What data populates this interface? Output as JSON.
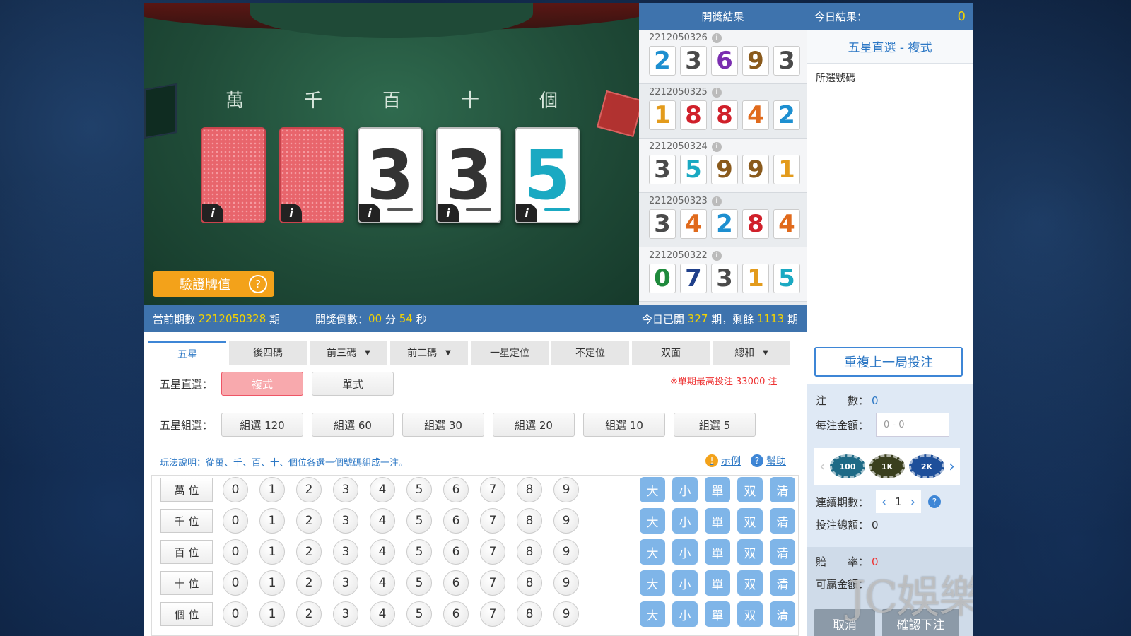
{
  "table": {
    "positions": [
      "萬",
      "千",
      "百",
      "十",
      "個"
    ],
    "cards": [
      "",
      "",
      "3",
      "3",
      "5"
    ],
    "card_info": "i",
    "verify_label": "驗證牌值",
    "verify_help": "?"
  },
  "results": {
    "title": "開獎結果",
    "draws": [
      {
        "id": "2212050326",
        "nums": [
          "2",
          "3",
          "6",
          "9",
          "3"
        ]
      },
      {
        "id": "2212050325",
        "nums": [
          "1",
          "8",
          "8",
          "4",
          "2"
        ]
      },
      {
        "id": "2212050324",
        "nums": [
          "3",
          "5",
          "9",
          "9",
          "1"
        ]
      },
      {
        "id": "2212050323",
        "nums": [
          "3",
          "4",
          "2",
          "8",
          "4"
        ]
      },
      {
        "id": "2212050322",
        "nums": [
          "0",
          "7",
          "3",
          "1",
          "5"
        ]
      }
    ],
    "digit_colors": {
      "0": "#1f8a3c",
      "1": "#e39b1c",
      "2": "#1d8fd0",
      "3": "#4a4a4a",
      "4": "#e06a1c",
      "5": "#1aa9c2",
      "6": "#7a2db0",
      "7": "#1f3f8a",
      "8": "#d0202a",
      "9": "#8a5a1c"
    }
  },
  "status": {
    "current_label": "當前期數",
    "current_id": "2212050328",
    "period_unit": "期",
    "countdown_label": "開獎倒數：",
    "minutes": "00",
    "min_unit": "分",
    "seconds": "54",
    "sec_unit": "秒",
    "today_label": "今日已開",
    "today_count": "327",
    "period_sep": "期，剩餘",
    "remaining": "1113",
    "period_end": "期"
  },
  "tabs": [
    {
      "label": "五星",
      "dropdown": false
    },
    {
      "label": "後四碼",
      "dropdown": false
    },
    {
      "label": "前三碼",
      "dropdown": true
    },
    {
      "label": "前二碼",
      "dropdown": true
    },
    {
      "label": "一星定位",
      "dropdown": false
    },
    {
      "label": "不定位",
      "dropdown": false
    },
    {
      "label": "双面",
      "dropdown": false
    },
    {
      "label": "總和",
      "dropdown": true
    }
  ],
  "direct": {
    "label": "五星直選：",
    "options": [
      "複式",
      "單式"
    ]
  },
  "max_note": "※單期最高投注 33000 注",
  "group": {
    "label": "五星組選：",
    "options": [
      "組選 120",
      "組選 60",
      "組選 30",
      "組選 20",
      "組選 10",
      "組選 5"
    ]
  },
  "howto": "玩法說明：從萬、千、百、十、個位各選一個號碼組成一注。",
  "links": {
    "example": "示例",
    "help": "幫助"
  },
  "grid": {
    "rows": [
      "萬 位",
      "千 位",
      "百 位",
      "十 位",
      "個 位"
    ],
    "numbers": [
      "0",
      "1",
      "2",
      "3",
      "4",
      "5",
      "6",
      "7",
      "8",
      "9"
    ],
    "quick": [
      "大",
      "小",
      "單",
      "双",
      "清"
    ]
  },
  "right": {
    "today_label": "今日結果：",
    "today_value": "0",
    "mode_title": "五星直選 - 複式",
    "selected_label": "所選號碼",
    "repeat_label": "重複上一局投注",
    "bets_label": "注　　數：",
    "bets_value": "0",
    "amount_label": "每注金額：",
    "amount_placeholder": "0 - 0",
    "chips": [
      {
        "label": "100",
        "color": "#1e6a86"
      },
      {
        "label": "1K",
        "color": "#3a3f1e"
      },
      {
        "label": "2K",
        "color": "#1e4f9a"
      }
    ],
    "periods_label": "連續期數：",
    "periods_value": "1",
    "total_label": "投注總額：",
    "total_value": "0",
    "odds_label": "賠　　率：",
    "odds_value": "0",
    "balance_label": "可贏金額：",
    "cancel_label": "取消",
    "confirm_label": "確認下注"
  },
  "watermark": "JC娛樂城版權所有"
}
